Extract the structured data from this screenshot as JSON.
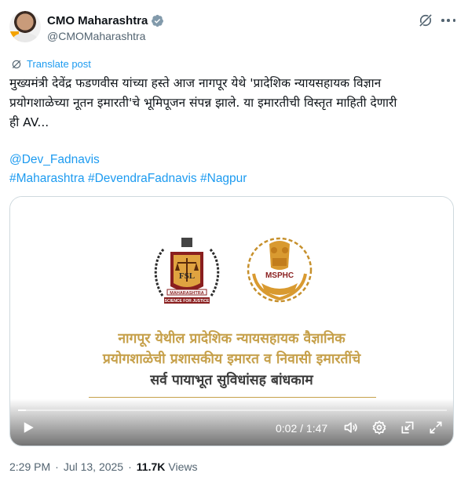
{
  "author": {
    "display_name": "CMO Maharashtra",
    "handle": "@CMOMaharashtra",
    "verified_color": "#829aab"
  },
  "translate": {
    "label": "Translate post"
  },
  "tweet": {
    "lines": [
      "मुख्यमंत्री देवेंद्र फडणवीस यांच्या हस्ते आज नागपूर येथे 'प्रादेशिक न्यायसहायक विज्ञान",
      "प्रयोगशाळेच्या नूतन इमारती'चे भूमिपूजन संपन्न झाले. या इमारतीची विस्तृत माहिती देणारी",
      "ही AV..."
    ],
    "mention": "@Dev_Fadnavis",
    "hashtags": [
      "#Maharashtra",
      "#DevendraFadnavis",
      "#Nagpur"
    ]
  },
  "video": {
    "logo_fsl_text": "FSL",
    "logo_fsl_sub": "MAHARASHTRA",
    "logo_fsl_motto": "SCIENCE FOR JUSTICE",
    "logo_msphc_text": "MSPHC",
    "title_lines": [
      "नागपूर येथील प्रादेशिक न्यायसहायक वैज्ञानिक",
      "प्रयोगशाळेची प्रशासकीय इमारत व निवासी इमारतींचे",
      "सर्व पायाभूत सुविधांसह बांधकाम"
    ],
    "time": "0:02 / 1:47",
    "progress": 0.019
  },
  "meta": {
    "time": "2:29 PM",
    "date": "Jul 13, 2025",
    "views_count": "11.7K",
    "views_label": "Views"
  },
  "colors": {
    "link": "#1d9bf0",
    "secondary": "#536471",
    "gold": "#c6a04a"
  }
}
